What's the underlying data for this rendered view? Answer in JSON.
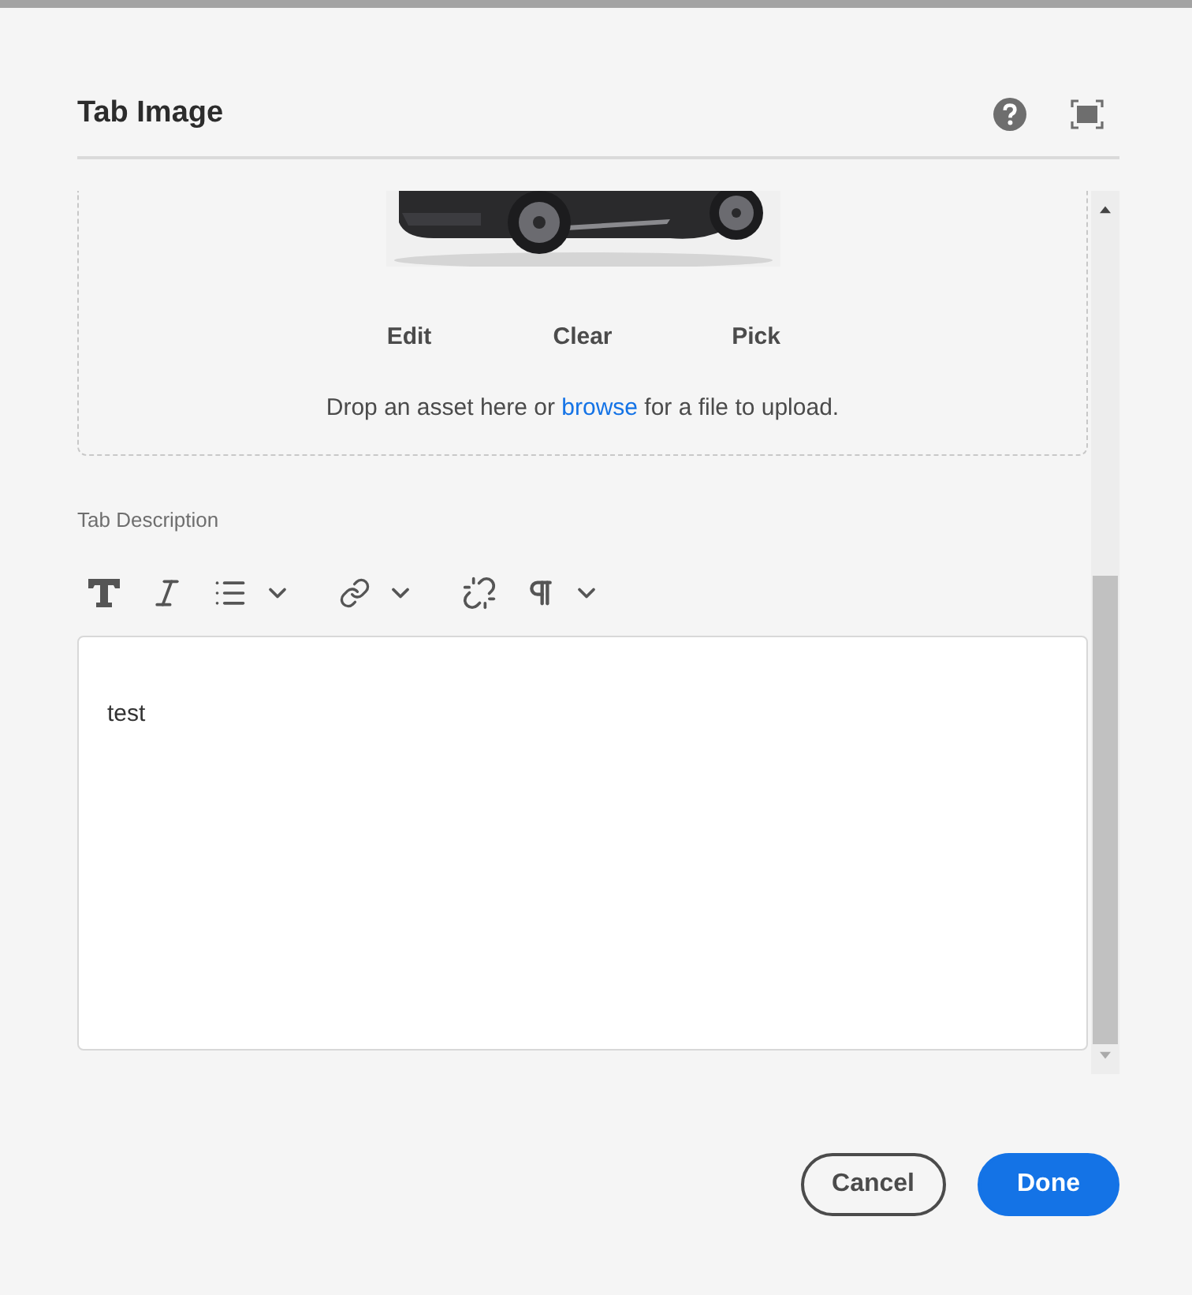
{
  "dialog": {
    "title": "Tab Image"
  },
  "image_field": {
    "actions": [
      "Edit",
      "Clear",
      "Pick"
    ],
    "hint_before": "Drop an asset here or ",
    "hint_link": "browse",
    "hint_after": " for a file to upload."
  },
  "description": {
    "label": "Tab Description",
    "value": "test",
    "toolbar": [
      {
        "kind": "bold",
        "menu": false
      },
      {
        "kind": "italic",
        "menu": false
      },
      {
        "kind": "list",
        "menu": true
      },
      {
        "kind": "link",
        "menu": true
      },
      {
        "kind": "unlink",
        "menu": false
      },
      {
        "kind": "paragraph",
        "menu": true
      }
    ]
  },
  "buttons": [
    {
      "label": "Cancel",
      "kind": "secondary"
    },
    {
      "label": "Done",
      "kind": "primary"
    }
  ]
}
